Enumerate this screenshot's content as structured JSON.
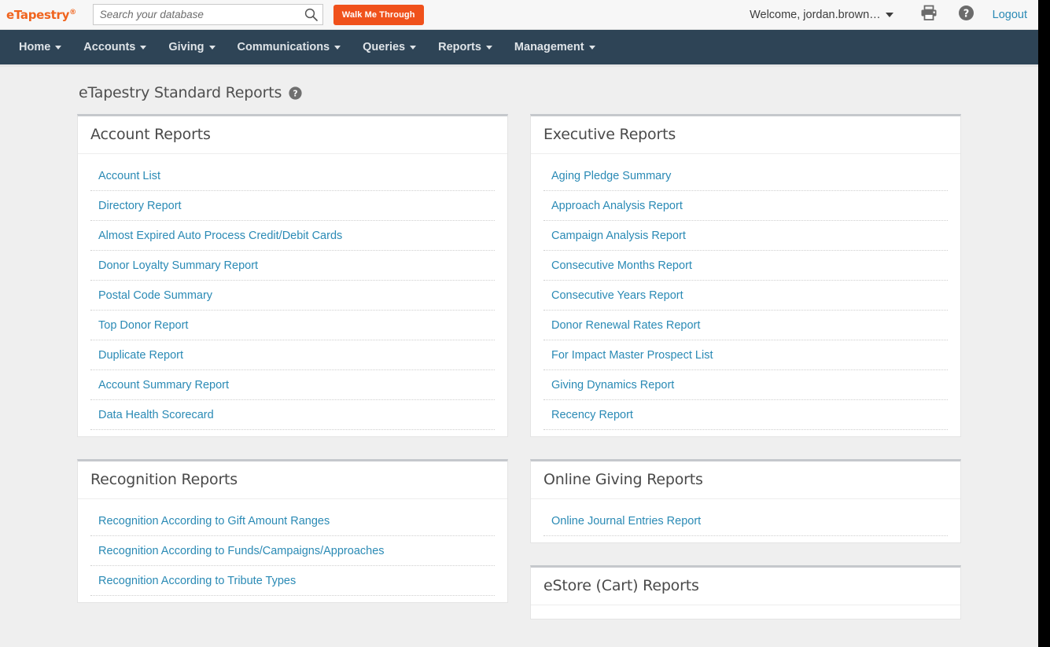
{
  "topbar": {
    "logo_text": "eTapestry",
    "logo_reg": "®",
    "search_placeholder": "Search your database",
    "search_value": "",
    "search_icon": "search-icon",
    "walk_me_through_label": "Walk Me Through",
    "welcome_text": "Welcome, jordan.brown…",
    "print_icon": "printer-icon",
    "help_icon": "help-circle-icon",
    "logout_label": "Logout",
    "accent_orange": "#f0511b",
    "link_blue": "#2a8ab5"
  },
  "nav": {
    "background": "#2e4456",
    "items": [
      {
        "label": "Home",
        "has_caret": true
      },
      {
        "label": "Accounts",
        "has_caret": true
      },
      {
        "label": "Giving",
        "has_caret": true
      },
      {
        "label": "Communications",
        "has_caret": true
      },
      {
        "label": "Queries",
        "has_caret": true
      },
      {
        "label": "Reports",
        "has_caret": true
      },
      {
        "label": "Management",
        "has_caret": true
      }
    ]
  },
  "page": {
    "title": "eTapestry Standard Reports",
    "title_help_icon": "help-circle-icon"
  },
  "panels": {
    "left": [
      {
        "id": "account-reports",
        "title": "Account Reports",
        "links": [
          "Account List",
          "Directory Report",
          "Almost Expired Auto Process Credit/Debit Cards",
          "Donor Loyalty Summary Report",
          "Postal Code Summary",
          "Top Donor Report",
          "Duplicate Report",
          "Account Summary Report",
          "Data Health Scorecard"
        ]
      },
      {
        "id": "recognition-reports",
        "title": "Recognition Reports",
        "links": [
          "Recognition According to Gift Amount Ranges",
          "Recognition According to Funds/Campaigns/Approaches",
          "Recognition According to Tribute Types"
        ]
      }
    ],
    "right": [
      {
        "id": "executive-reports",
        "title": "Executive Reports",
        "links": [
          "Aging Pledge Summary",
          "Approach Analysis Report",
          "Campaign Analysis Report",
          "Consecutive Months Report",
          "Consecutive Years Report",
          "Donor Renewal Rates Report",
          "For Impact Master Prospect List",
          "Giving Dynamics Report",
          "Recency Report"
        ]
      },
      {
        "id": "online-giving-reports",
        "title": "Online Giving Reports",
        "links": [
          "Online Journal Entries Report"
        ]
      },
      {
        "id": "estore-cart-reports",
        "title": "eStore (Cart) Reports",
        "links": []
      }
    ]
  }
}
